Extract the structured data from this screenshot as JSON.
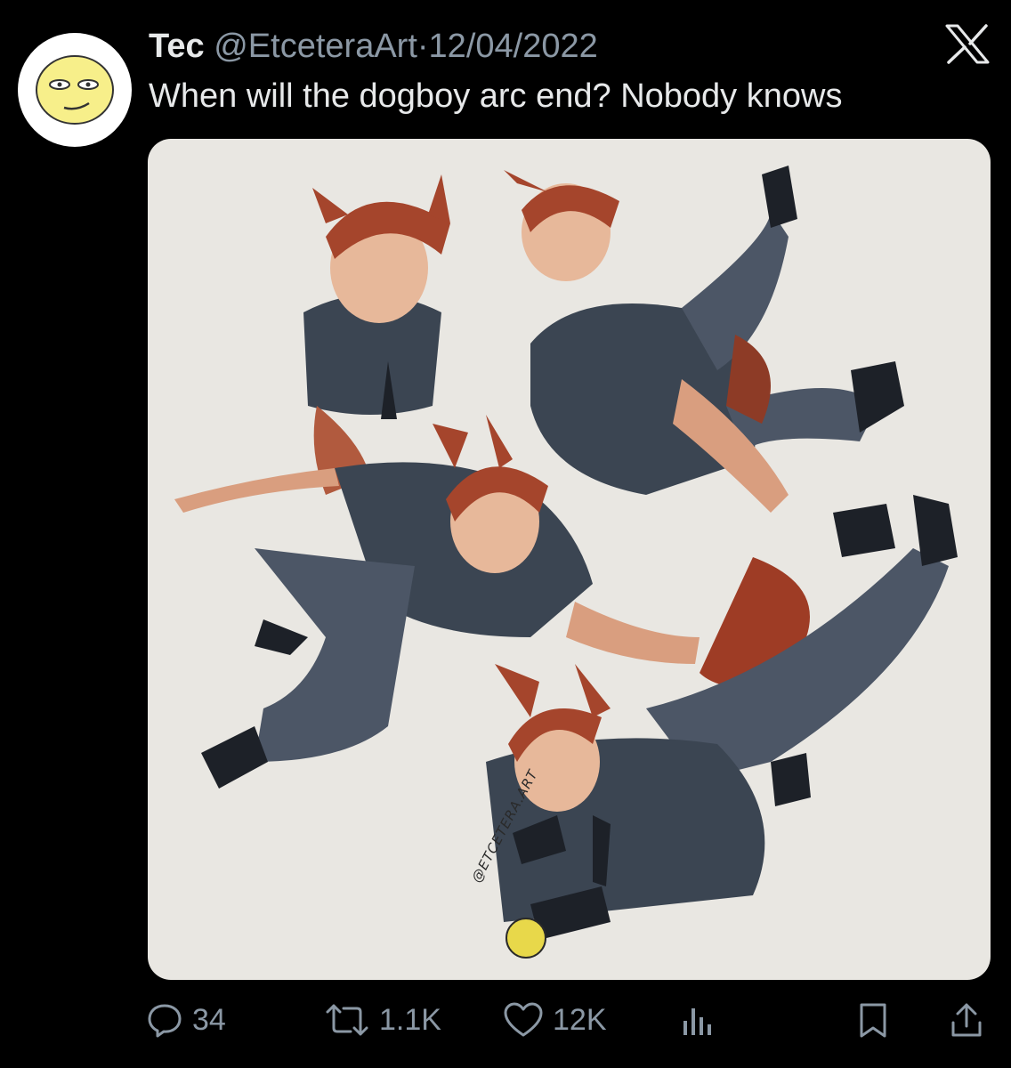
{
  "tweet": {
    "display_name": "Tec",
    "handle": "@EtceteraArt",
    "separator": "·",
    "date": "12/04/2022",
    "text": "When will the dogboy arc end? Nobody knows",
    "media_watermark": "@ETCETERA.ART"
  },
  "icons": {
    "brand": "x-logo-icon",
    "reply": "reply-icon",
    "retweet": "retweet-icon",
    "like": "heart-icon",
    "views": "views-icon",
    "bookmark": "bookmark-icon",
    "share": "share-icon"
  },
  "actions": {
    "replies": "34",
    "retweets": "1.1K",
    "likes": "12K"
  },
  "colors": {
    "background": "#000000",
    "text_primary": "#e7e9ea",
    "text_secondary": "#8b98a5",
    "media_bg": "#e9e7e2",
    "avatar_face": "#f7ef8a"
  }
}
